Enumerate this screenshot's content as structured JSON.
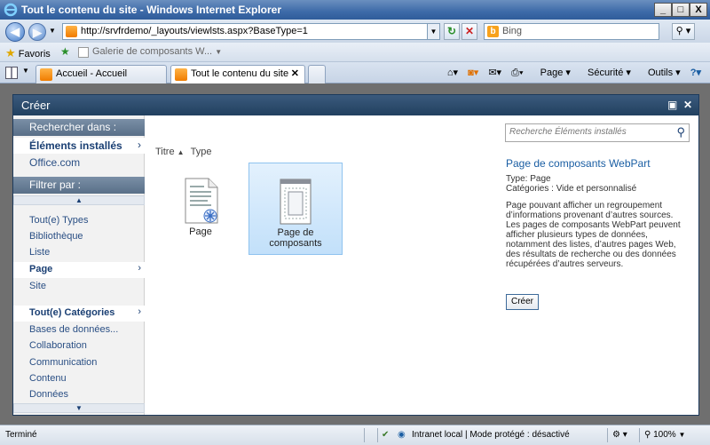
{
  "window": {
    "title": "Tout le contenu du site - Windows Internet Explorer",
    "min_label": "_",
    "max_label": "□",
    "close_label": "X"
  },
  "addressbar": {
    "url": "http://srvfrdemo/_layouts/viewlsts.aspx?BaseType=1",
    "search_placeholder": "Bing"
  },
  "favorites": {
    "label": "Favoris",
    "gallery_link": "Galerie de composants W..."
  },
  "tabs": [
    {
      "label": "Accueil - Accueil",
      "active": false
    },
    {
      "label": "Tout le contenu du site",
      "active": true
    }
  ],
  "commandbar": {
    "page": "Page",
    "security": "Sécurité",
    "tools": "Outils"
  },
  "dialog": {
    "title": "Créer",
    "search_in_header": "Rechercher dans :",
    "search_in_items": [
      {
        "label": "Éléments installés",
        "selected": true
      },
      {
        "label": "Office.com",
        "selected": false
      }
    ],
    "filter_header": "Filtrer par :",
    "type_items": [
      {
        "label": "Tout(e) Types",
        "selected": false
      },
      {
        "label": "Bibliothèque",
        "selected": false
      },
      {
        "label": "Liste",
        "selected": false
      },
      {
        "label": "Page",
        "selected": true
      },
      {
        "label": "Site",
        "selected": false
      }
    ],
    "category_items": [
      {
        "label": "Tout(e) Catégories",
        "selected": true
      },
      {
        "label": "Bases de données...",
        "selected": false
      },
      {
        "label": "Collaboration",
        "selected": false
      },
      {
        "label": "Communication",
        "selected": false
      },
      {
        "label": "Contenu",
        "selected": false
      },
      {
        "label": "Données",
        "selected": false
      }
    ],
    "sort": {
      "title": "Titre",
      "type": "Type"
    },
    "tiles": [
      {
        "label": "Page",
        "selected": false
      },
      {
        "label": "Page de composants",
        "selected": true
      }
    ],
    "search_placeholder": "Recherche Éléments installés",
    "detail": {
      "title": "Page de composants WebPart",
      "type": "Type: Page",
      "categories": "Catégories : Vide et personnalisé",
      "description": "Page pouvant afficher un regroupement d’informations provenant d’autres sources. Les pages de composants WebPart peuvent afficher plusieurs types de données, notamment des listes, d’autres pages Web, des résultats de recherche ou des données récupérées d’autres serveurs.",
      "create_label": "Créer"
    }
  },
  "statusbar": {
    "status": "Terminé",
    "zone": "Intranet local | Mode protégé : désactivé",
    "zoom": "100%"
  }
}
